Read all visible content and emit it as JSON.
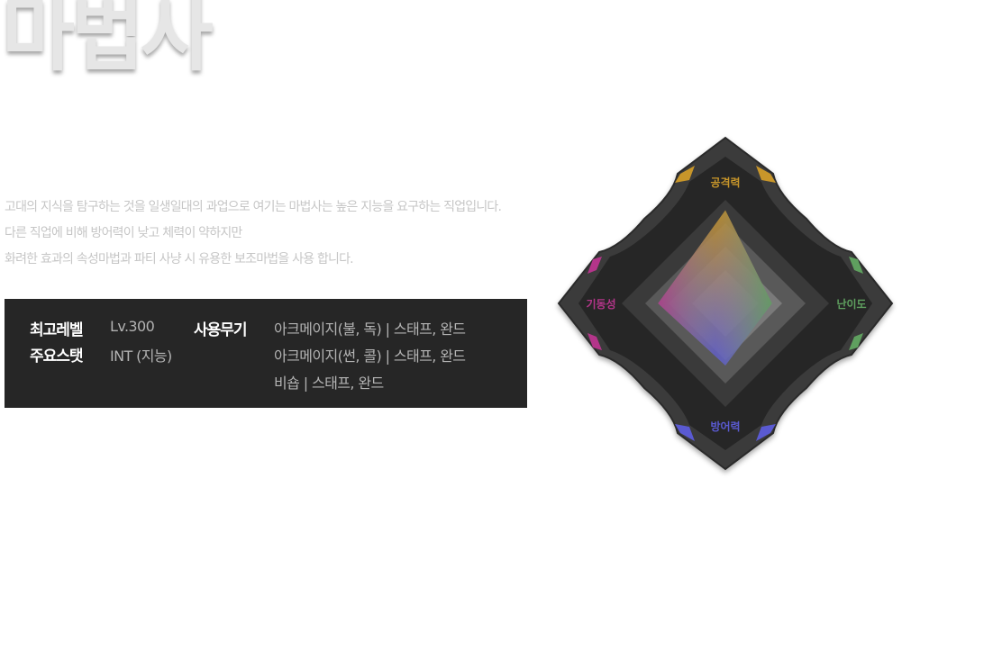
{
  "title": "마법사",
  "description": [
    "고대의 지식을 탐구하는 것을 일생일대의 과업으로 여기는 마법사는 높은 지능을 요구하는 직업입니다.",
    "다른 직업에 비해 방어력이 낮고 체력이 약하지만",
    "화려한 효과의 속성마법과 파티 사냥 시 유용한 보조마법을 사용 합니다."
  ],
  "info": {
    "max_level_label": "최고레벨",
    "max_level_value": "Lv.300",
    "main_stat_label": "주요스탯",
    "main_stat_value": "INT (지능)",
    "weapon_label": "사용무기",
    "weapons": [
      "아크메이지(불, 독) | 스태프, 완드",
      "아크메이지(썬, 콜) | 스태프, 완드",
      "비숍 | 스태프, 완드"
    ]
  },
  "radar": {
    "labels": {
      "attack": "공격력",
      "difficulty": "난이도",
      "defense": "방어력",
      "mobility": "기동성"
    },
    "levels": {
      "attack": 0.9,
      "difficulty": 0.45,
      "defense": 0.6,
      "mobility": 0.65
    },
    "colors": {
      "attack": "#c8962a",
      "difficulty": "#5fa05f",
      "defense": "#5a5ad2",
      "mobility": "#b4358a"
    }
  }
}
